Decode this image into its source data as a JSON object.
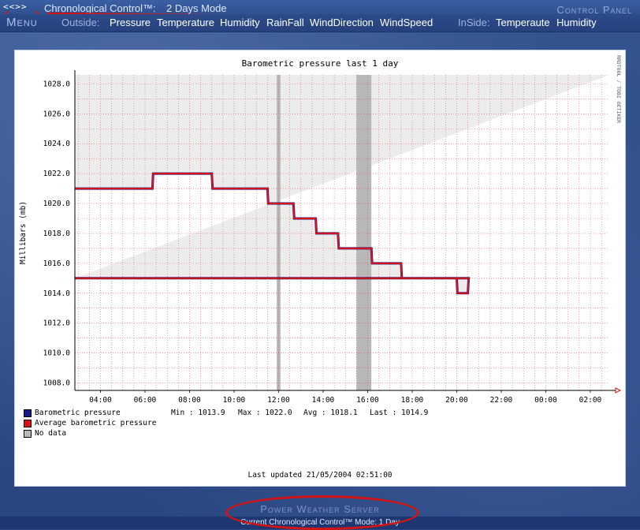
{
  "header": {
    "nav_arrows": "<<>>",
    "app_title": "Chronological Control™:",
    "mode_label": "2 Days Mode",
    "control_panel": "Control Panel"
  },
  "menu": {
    "label": "Menu",
    "outside_label": "Outside:",
    "outside_links": [
      "Pressure",
      "Temperature",
      "Humidity",
      "RainFall",
      "WindDirection",
      "WindSpeed"
    ],
    "inside_label": "InSide:",
    "inside_links": [
      "Temperaute",
      "Humidity"
    ]
  },
  "chart_data": {
    "type": "line",
    "title": "Barometric pressure last 1 day",
    "ylabel": "Millibars (mb)",
    "side_credit": "RRDTOOL / TOBI OETIKER",
    "ylim": [
      1007.5,
      1028.6
    ],
    "y_ticks": [
      "1008.0",
      "1010.0",
      "1012.0",
      "1014.0",
      "1016.0",
      "1018.0",
      "1020.0",
      "1022.0",
      "1024.0",
      "1026.0",
      "1028.0"
    ],
    "x_ticks": [
      "04:00",
      "06:00",
      "08:00",
      "10:00",
      "12:00",
      "14:00",
      "16:00",
      "18:00",
      "20:00",
      "22:00",
      "00:00",
      "02:00"
    ],
    "series": [
      {
        "name": "Barometric pressure",
        "color": "#1a1a8c",
        "points": [
          [
            "02:51",
            1021.0
          ],
          [
            "06:20",
            1021.0
          ],
          [
            "06:22",
            1022.0
          ],
          [
            "09:00",
            1022.0
          ],
          [
            "09:02",
            1021.0
          ],
          [
            "11:30",
            1021.0
          ],
          [
            "11:32",
            1020.0
          ],
          [
            "12:40",
            1020.0
          ],
          [
            "12:42",
            1019.0
          ],
          [
            "13:40",
            1019.0
          ],
          [
            "13:42",
            1018.0
          ],
          [
            "14:40",
            1018.0
          ],
          [
            "14:42",
            1017.0
          ],
          [
            "15:10",
            1017.0
          ],
          [
            "16:10",
            1017.0
          ],
          [
            "16:12",
            1016.0
          ],
          [
            "17:30",
            1016.0
          ],
          [
            "17:32",
            1015.0
          ],
          [
            "20:00",
            1015.0
          ],
          [
            "20:02",
            1014.0
          ],
          [
            "20:30",
            1014.0
          ],
          [
            "20:32",
            1015.0
          ],
          [
            "02:51",
            1015.0
          ]
        ]
      },
      {
        "name": "Average barometric pressure",
        "color": "#dd1111",
        "points": [
          [
            "02:51",
            1021.0
          ],
          [
            "06:20",
            1021.0
          ],
          [
            "06:22",
            1022.0
          ],
          [
            "09:00",
            1022.0
          ],
          [
            "09:02",
            1021.0
          ],
          [
            "11:30",
            1021.0
          ],
          [
            "11:32",
            1020.0
          ],
          [
            "12:40",
            1020.0
          ],
          [
            "12:42",
            1019.0
          ],
          [
            "13:40",
            1019.0
          ],
          [
            "13:42",
            1018.0
          ],
          [
            "14:40",
            1018.0
          ],
          [
            "14:42",
            1017.0
          ],
          [
            "15:10",
            1017.0
          ],
          [
            "16:10",
            1017.0
          ],
          [
            "16:12",
            1016.0
          ],
          [
            "17:30",
            1016.0
          ],
          [
            "17:32",
            1015.0
          ],
          [
            "20:00",
            1015.0
          ],
          [
            "20:02",
            1014.0
          ],
          [
            "20:30",
            1014.0
          ],
          [
            "20:32",
            1015.0
          ],
          [
            "02:51",
            1015.0
          ]
        ]
      }
    ],
    "no_data_ranges": [
      [
        "11:55",
        "12:05"
      ],
      [
        "15:30",
        "16:10"
      ]
    ],
    "legend": [
      {
        "label": "Barometric pressure",
        "color": "#1a1a8c"
      },
      {
        "label": "Average barometric pressure",
        "color": "#dd1111"
      },
      {
        "label": "No data",
        "color": "#b8b8b8"
      }
    ],
    "stats": {
      "min": "Min : 1013.9",
      "max": "Max : 1022.0",
      "avg": "Avg : 1018.1",
      "last": "Last : 1014.9"
    },
    "last_updated": "Last updated 21/05/2004 02:51:00"
  },
  "footer": {
    "brand": "Power Weather Server",
    "mode": "Current Chronological Control™ Mode: 1 Day"
  },
  "colors": {
    "background": "#2d4a86",
    "grid": "#e23b3b",
    "panel": "#ffffff"
  }
}
